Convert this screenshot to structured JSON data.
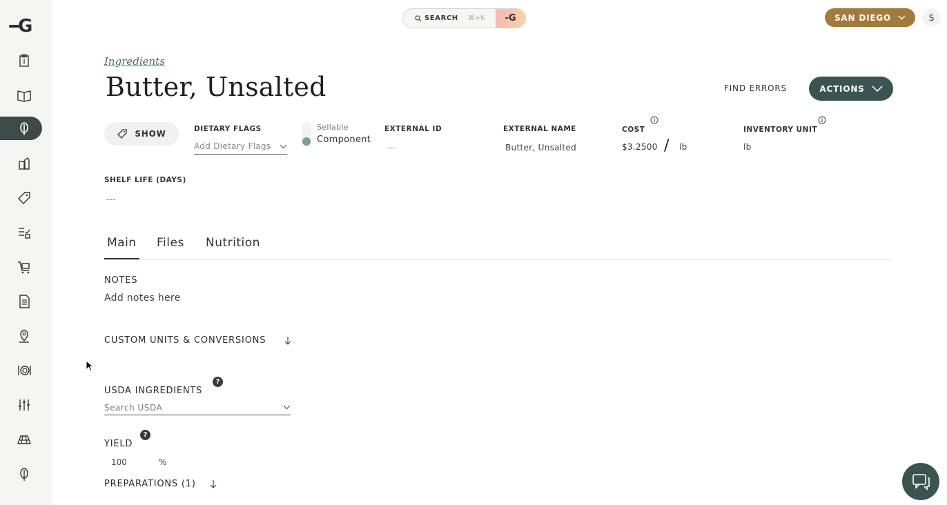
{
  "sidebar": {
    "logo": "G",
    "items": [
      {
        "icon": "clipboard-icon"
      },
      {
        "icon": "book-icon"
      },
      {
        "icon": "ingredient-leaf-icon",
        "active": true
      },
      {
        "icon": "containers-icon"
      },
      {
        "icon": "tag-icon"
      },
      {
        "icon": "checklist-icon"
      },
      {
        "icon": "cart-icon"
      },
      {
        "icon": "document-icon"
      },
      {
        "icon": "location-pin-icon"
      },
      {
        "icon": "dining-icon"
      },
      {
        "icon": "sliders-icon"
      },
      {
        "icon": "map-icon"
      },
      {
        "icon": "leaf-icon"
      }
    ]
  },
  "topbar": {
    "search_label": "SEARCH",
    "search_shortcut": "⌘+K",
    "search_badge": "-G",
    "location": "SAN DIEGO",
    "user_initial": "S"
  },
  "header": {
    "breadcrumb": "Ingredients",
    "title": "Butter, Unsalted",
    "find_errors": "FIND ERRORS",
    "actions": "ACTIONS"
  },
  "fields": {
    "show_label": "SHOW",
    "dietary_flags_label": "DIETARY FLAGS",
    "dietary_flags_placeholder": "Add Dietary Flags",
    "toggle_sellable": "Sellable",
    "toggle_component": "Component",
    "external_id_label": "EXTERNAL ID",
    "external_id_value": "---",
    "external_name_label": "EXTERNAL NAME",
    "external_name_value": "Butter, Unsalted",
    "cost_label": "COST",
    "cost_value": "$3.2500",
    "cost_separator": "/",
    "cost_unit": "lb",
    "inventory_unit_label": "INVENTORY UNIT",
    "inventory_unit_value": "lb",
    "shelf_life_label": "SHELF LIFE (DAYS)",
    "shelf_life_value": "---"
  },
  "tabs": [
    {
      "label": "Main",
      "active": true
    },
    {
      "label": "Files"
    },
    {
      "label": "Nutrition"
    }
  ],
  "main": {
    "notes_label": "NOTES",
    "notes_placeholder": "Add notes here",
    "custom_units_label": "CUSTOM UNITS & CONVERSIONS",
    "usda_label": "USDA INGREDIENTS",
    "usda_placeholder": "Search USDA",
    "yield_label": "YIELD",
    "yield_value": "100",
    "yield_unit": "%",
    "preparations_label": "PREPARATIONS (1)"
  },
  "colors": {
    "accent_dark": "#3b5452",
    "location_gold": "#a07b3c",
    "sidebar_bg": "#f5f5f4"
  }
}
